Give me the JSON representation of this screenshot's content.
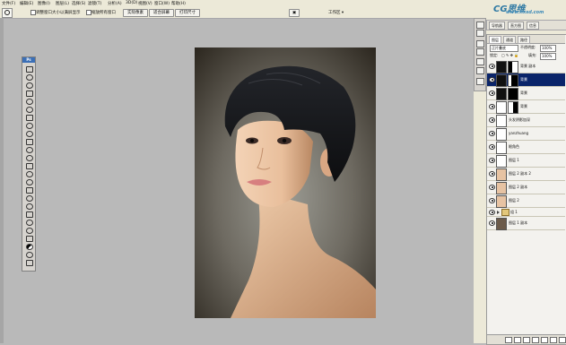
{
  "menu": {
    "items": [
      "文件(F)",
      "编辑(E)",
      "图像(I)",
      "图层(L)",
      "选择(S)",
      "滤镜(T)",
      "分析(A)",
      "3D(D)",
      "视图(V)",
      "窗口(W)",
      "帮助(H)"
    ]
  },
  "options": {
    "resize_windows_label": "调整窗口大小以满屏显示",
    "zoom_all_label": "缩放所有窗口",
    "actual_pixels": "实际像素",
    "fit_screen": "适合屏幕",
    "print_size": "打印尺寸",
    "workspace": "工作区 ▾"
  },
  "tools_panel": {
    "badge": "Ps"
  },
  "panels": {
    "top_tabs": [
      "导航器",
      "直方图",
      "信息"
    ],
    "layer_tabs": [
      "图层",
      "通道",
      "路径"
    ],
    "blend_mode": "正片叠底",
    "opacity_label": "不透明度:",
    "opacity_value": "100%",
    "lock_label": "锁定:",
    "fill_label": "填充:",
    "fill_value": "100%"
  },
  "layers": [
    {
      "name": "背景 副本",
      "selected": false,
      "kind": "masked"
    },
    {
      "name": "背景",
      "selected": true,
      "kind": "masked"
    },
    {
      "name": "背景",
      "selected": false,
      "kind": "masked"
    },
    {
      "name": "背景",
      "selected": false,
      "kind": "masked"
    },
    {
      "name": "头发阴影加深",
      "selected": false,
      "kind": "plain"
    },
    {
      "name": "yanzhuang",
      "selected": false,
      "kind": "plain"
    },
    {
      "name": "眼角色",
      "selected": false,
      "kind": "plain"
    },
    {
      "name": "图层 1",
      "selected": false,
      "kind": "plain"
    },
    {
      "name": "图层 2 副本 2",
      "selected": false,
      "kind": "portrait"
    },
    {
      "name": "图层 2 副本",
      "selected": false,
      "kind": "portrait"
    },
    {
      "name": "图层 2",
      "selected": false,
      "kind": "portrait"
    },
    {
      "name": "组 1",
      "selected": false,
      "kind": "group"
    },
    {
      "name": "图层 1 副本",
      "selected": false,
      "kind": "portrait"
    }
  ],
  "watermark": {
    "title": "CG思维",
    "sub": "www.hxsd.com"
  },
  "colors": {
    "selected_row": "#0a246a",
    "chrome": "#ece9d8",
    "workspace": "#b9b9b9"
  }
}
